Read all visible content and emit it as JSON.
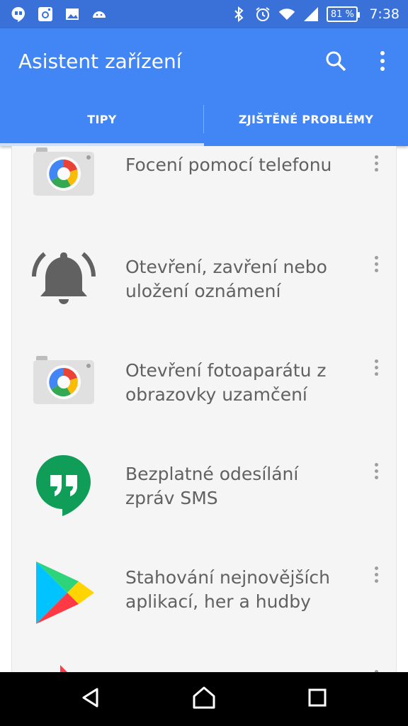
{
  "status_bar": {
    "battery": "81 %",
    "time": "7:38",
    "left_icons": [
      "hangouts-icon",
      "instagram-icon",
      "gallery-icon",
      "android-icon"
    ],
    "right_icons": [
      "bluetooth-icon",
      "alarm-icon",
      "wifi-icon",
      "signal-icon"
    ]
  },
  "app_bar": {
    "title": "Asistent zařízení",
    "actions": [
      "search-icon",
      "more-vert-icon"
    ]
  },
  "tabs": [
    {
      "label": "TIPY",
      "selected": true
    },
    {
      "label": "ZJIŠTĚNÉ PROBLÉMY",
      "selected": false
    }
  ],
  "items": [
    {
      "icon": "camera-icon",
      "label": "Focení pomocí telefonu"
    },
    {
      "icon": "bell-icon",
      "label": "Otevření, zavření nebo uložení oznámení"
    },
    {
      "icon": "camera-icon",
      "label": "Otevření fotoaparátu z obrazovky uzamčení"
    },
    {
      "icon": "hangouts-icon",
      "label": "Bezplatné odesílání zpráv SMS"
    },
    {
      "icon": "play-store-icon",
      "label": "Stahování nejnovějších aplikací, her a hudby"
    },
    {
      "icon": "play-store-icon",
      "label": ""
    }
  ],
  "navigation": [
    "back-icon",
    "home-icon",
    "recents-icon"
  ],
  "colors": {
    "status_bar": "#3a71d8",
    "app_bar": "#4285f4",
    "content_bg": "#f5f5f5",
    "text": "#616161"
  }
}
